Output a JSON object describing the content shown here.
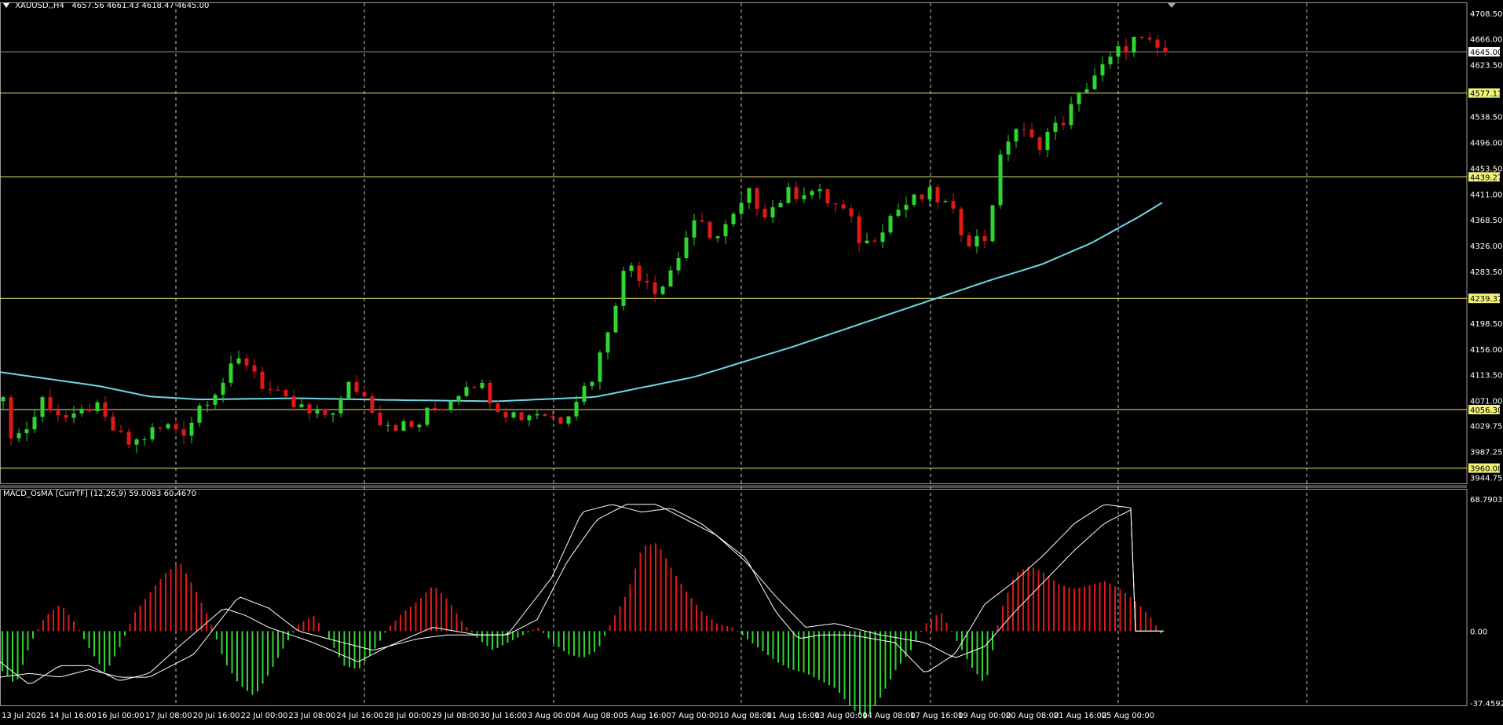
{
  "header": {
    "symbol": "XAUUSD,,H4",
    "ohlc": "4657.56 4661.43 4618.47 4645.00"
  },
  "indicator": {
    "title": "MACD_OsMA [CurrTF] (12,26,9) 59.0083 60.4670",
    "axis_labels": [
      "68.7903",
      "0.00",
      "-37.4592"
    ]
  },
  "price_axis": {
    "labels": [
      "4708.50",
      "4666.00",
      "4623.50",
      "4538.50",
      "4496.00",
      "4453.50",
      "4411.00",
      "4368.50",
      "4326.00",
      "4283.50",
      "4198.50",
      "4156.00",
      "4113.50",
      "4071.00",
      "4029.75",
      "3987.25",
      "3944.75"
    ],
    "current_price": "4645.00",
    "levels": [
      "4577.11",
      "4439.27",
      "4239.37",
      "4056.30",
      "3960.08"
    ]
  },
  "time_axis": {
    "labels": [
      "13 Jul 2026",
      "14 Jul 16:00",
      "16 Jul 00:00",
      "17 Jul 08:00",
      "20 Jul 16:00",
      "22 Jul 00:00",
      "23 Jul 08:00",
      "24 Jul 16:00",
      "28 Jul 00:00",
      "29 Jul 08:00",
      "30 Jul 16:00",
      "3 Aug 00:00",
      "4 Aug 08:00",
      "5 Aug 16:00",
      "7 Aug 00:00",
      "10 Aug 08:00",
      "11 Aug 16:00",
      "13 Aug 00:00",
      "14 Aug 08:00",
      "17 Aug 16:00",
      "19 Aug 00:00",
      "20 Aug 08:00",
      "21 Aug 16:00",
      "25 Aug 00:00"
    ]
  },
  "colors": {
    "bull": "#2fd42f",
    "bear": "#e01818",
    "ma": "#6fd6e6",
    "level": "#e8e870",
    "grid": "#c8c8c8",
    "current_price_bg": "#ffffff",
    "level_label_bg": "#f2f27a"
  },
  "chart_data": {
    "type": "candlestick",
    "series": [
      {
        "name": "candles",
        "values": []
      },
      {
        "name": "ma",
        "values": []
      }
    ],
    "price_range": [
      3935,
      4725
    ],
    "macd_range": [
      -37.4592,
      68.7903
    ]
  }
}
